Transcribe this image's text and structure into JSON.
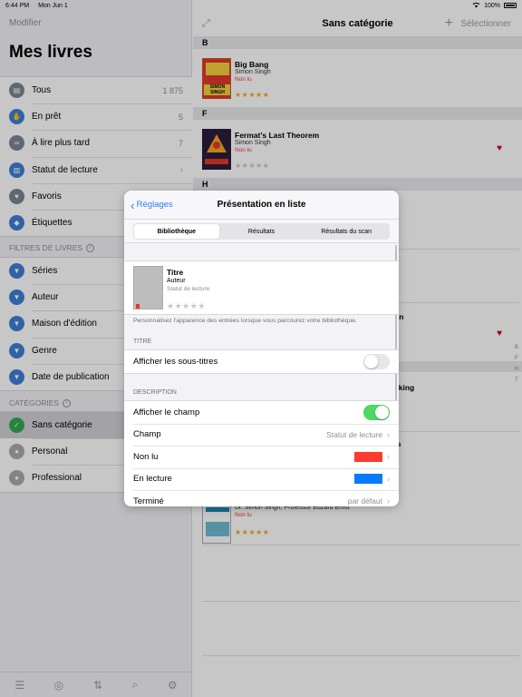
{
  "status_bar": {
    "time": "6:44 PM",
    "date": "Mon Jun 1",
    "battery": "100%"
  },
  "colors": {
    "accent": "#2f7cf6",
    "toggle_on": "#4cd964",
    "unread": "#ff3b30",
    "reading": "#0a7aff"
  },
  "sidebar": {
    "edit_label": "Modifier",
    "title": "Mes livres",
    "library": [
      {
        "icon": "books-icon",
        "label": "Tous",
        "count": "1 875"
      },
      {
        "icon": "lend-icon",
        "label": "En prêt",
        "count": "5"
      },
      {
        "icon": "glasses-icon",
        "label": "À lire plus tard",
        "count": "7"
      },
      {
        "icon": "reading-status-icon",
        "label": "Statut de lecture",
        "chevron": "›"
      },
      {
        "icon": "heart-icon",
        "label": "Favoris"
      },
      {
        "icon": "tag-icon",
        "label": "Étiquettes"
      }
    ],
    "filters_header": "FILTRES DE LIVRES",
    "filters": [
      {
        "label": "Séries"
      },
      {
        "label": "Auteur"
      },
      {
        "label": "Maison d'édition"
      },
      {
        "label": "Genre"
      },
      {
        "label": "Date de publication"
      }
    ],
    "categories_header": "CATÉGORIES",
    "categories": [
      {
        "label": "Sans catégorie",
        "selected": true
      },
      {
        "label": "Personal"
      },
      {
        "label": "Professional"
      }
    ]
  },
  "main": {
    "title": "Sans catégorie",
    "select_label": "Sélectionner",
    "sections": [
      {
        "letter": "B"
      },
      {
        "letter": "F"
      },
      {
        "letter": "H"
      }
    ],
    "books": [
      {
        "title": "Big Bang",
        "author": "Simon Singh",
        "status": "Non lu",
        "stars": "★★★★★",
        "cover_text": "SIMON SINGH"
      },
      {
        "title": "Fermat's Last Theorem",
        "author": "Simon Singh",
        "status": "Non lu",
        "stars": "★★★★★"
      },
      {
        "author": "Dr. Simon Singh, Professor Edzard Ernst",
        "status": "Non lu",
        "stars": "★★★★★"
      }
    ],
    "partial_titles": [
      "gn",
      "aking",
      "ts"
    ],
    "index": [
      "B",
      "F",
      "H",
      "T"
    ]
  },
  "modal": {
    "back_label": "Réglages",
    "title": "Présentation en liste",
    "tabs": [
      "Bibliothèque",
      "Résultats",
      "Résultats du scan"
    ],
    "active_tab": 0,
    "preview": {
      "title": "Titre",
      "author": "Auteur",
      "status": "Statut de lecture",
      "stars": "★★★★★"
    },
    "note": "Personnalisez l'apparence des entrées lorsque vous parcourez votre bibliothèque.",
    "title_section": {
      "header": "TITRE",
      "rows": [
        {
          "label": "Afficher les sous-titres",
          "toggle": false
        }
      ]
    },
    "description_section": {
      "header": "DESCRIPTION",
      "rows": [
        {
          "label": "Afficher le champ",
          "toggle": true
        },
        {
          "label": "Champ",
          "value": "Statut de lecture"
        },
        {
          "label": "Non lu",
          "color": "#ff3b30"
        },
        {
          "label": "En lecture",
          "color": "#0a7aff"
        },
        {
          "label": "Terminé",
          "value": "par défaut"
        }
      ]
    }
  }
}
